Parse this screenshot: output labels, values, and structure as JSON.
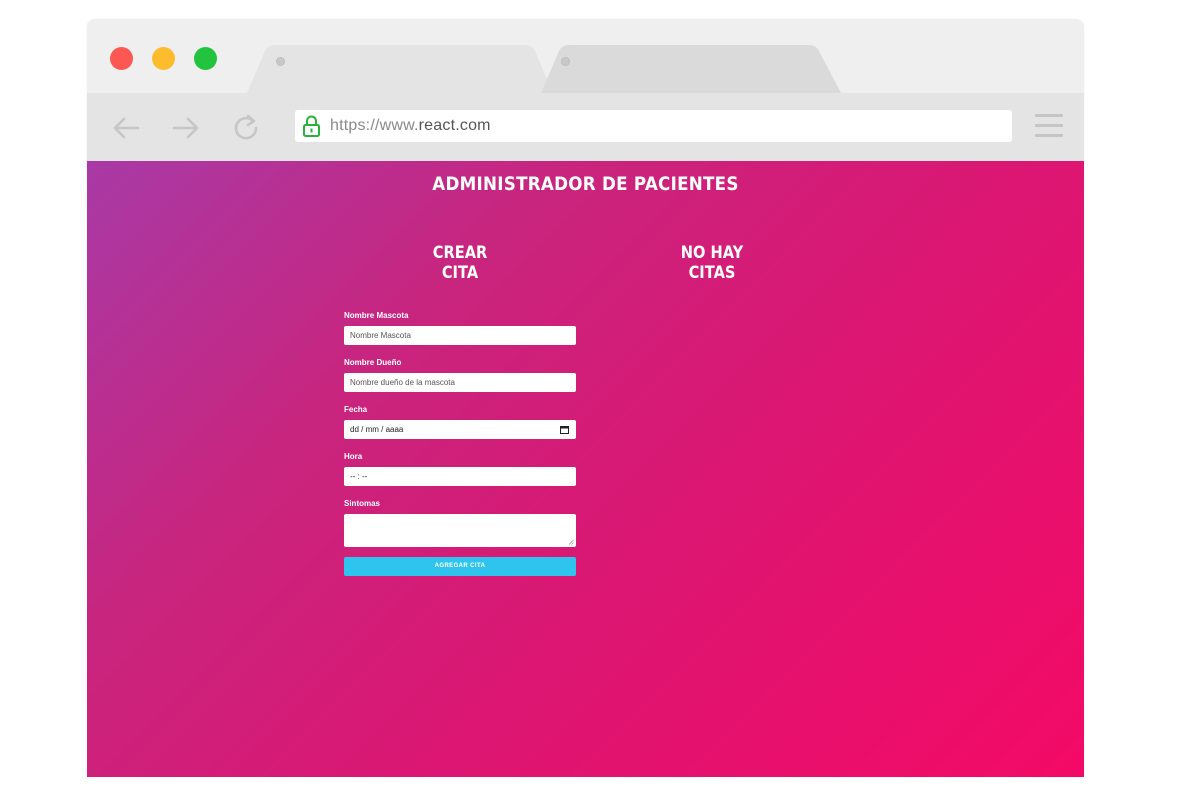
{
  "browser": {
    "traffic_lights": {
      "close": "#fd5753",
      "minimize": "#fdbc2d",
      "maximize": "#22c33f"
    },
    "url": {
      "scheme": "https://www.",
      "host": "react.com"
    }
  },
  "app": {
    "title": "ADMINISTRADOR DE PACIENTES",
    "form_title": "CREAR CITA",
    "list_title": "NO HAY CITAS",
    "form": {
      "pet_label": "Nombre Mascota",
      "pet_placeholder": "Nombre Mascota",
      "owner_label": "Nombre Dueño",
      "owner_placeholder": "Nombre dueño de la mascota",
      "date_label": "Fecha",
      "date_value": "dd / mm / aaaa",
      "time_label": "Hora",
      "time_value": "-- : --",
      "symptoms_label": "Sintomas",
      "submit_label": "AGREGAR CITA"
    },
    "colors": {
      "button": "#2fc4ee",
      "gradient_start": "#a83aa6",
      "gradient_end": "#f30a66"
    }
  }
}
